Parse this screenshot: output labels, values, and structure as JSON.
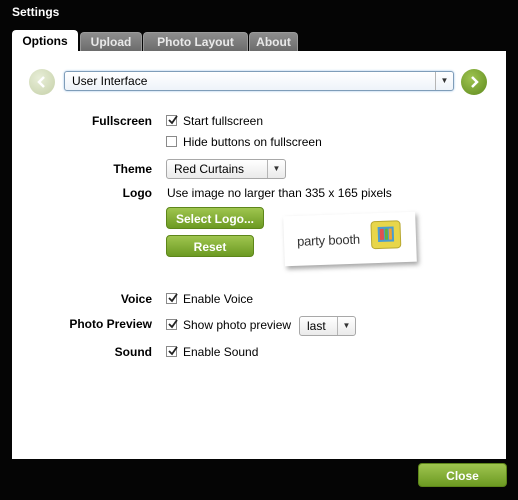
{
  "window": {
    "title": "Settings"
  },
  "tabs": [
    {
      "label": "Options",
      "active": true
    },
    {
      "label": "Upload",
      "active": false
    },
    {
      "label": "Photo Layout",
      "active": false
    },
    {
      "label": "About",
      "active": false
    }
  ],
  "section_select": {
    "value": "User Interface"
  },
  "fullscreen": {
    "label": "Fullscreen",
    "start": {
      "label": "Start fullscreen",
      "checked": true
    },
    "hide_buttons": {
      "label": "Hide buttons on fullscreen",
      "checked": false
    }
  },
  "theme": {
    "label": "Theme",
    "value": "Red Curtains"
  },
  "logo": {
    "label": "Logo",
    "hint": "Use image no larger than 335 x 165 pixels",
    "select_button": "Select Logo...",
    "reset_button": "Reset",
    "preview_text": "party booth"
  },
  "voice": {
    "label": "Voice",
    "option": {
      "label": "Enable Voice",
      "checked": true
    }
  },
  "photo_preview": {
    "label": "Photo Preview",
    "option": {
      "label": "Show photo preview",
      "checked": true
    },
    "mode": "last"
  },
  "sound": {
    "label": "Sound",
    "option": {
      "label": "Enable Sound",
      "checked": true
    }
  },
  "footer": {
    "close_button": "Close"
  },
  "colors": {
    "accent_green": "#7aa82c",
    "background": "#050505",
    "panel": "#ffffff"
  }
}
